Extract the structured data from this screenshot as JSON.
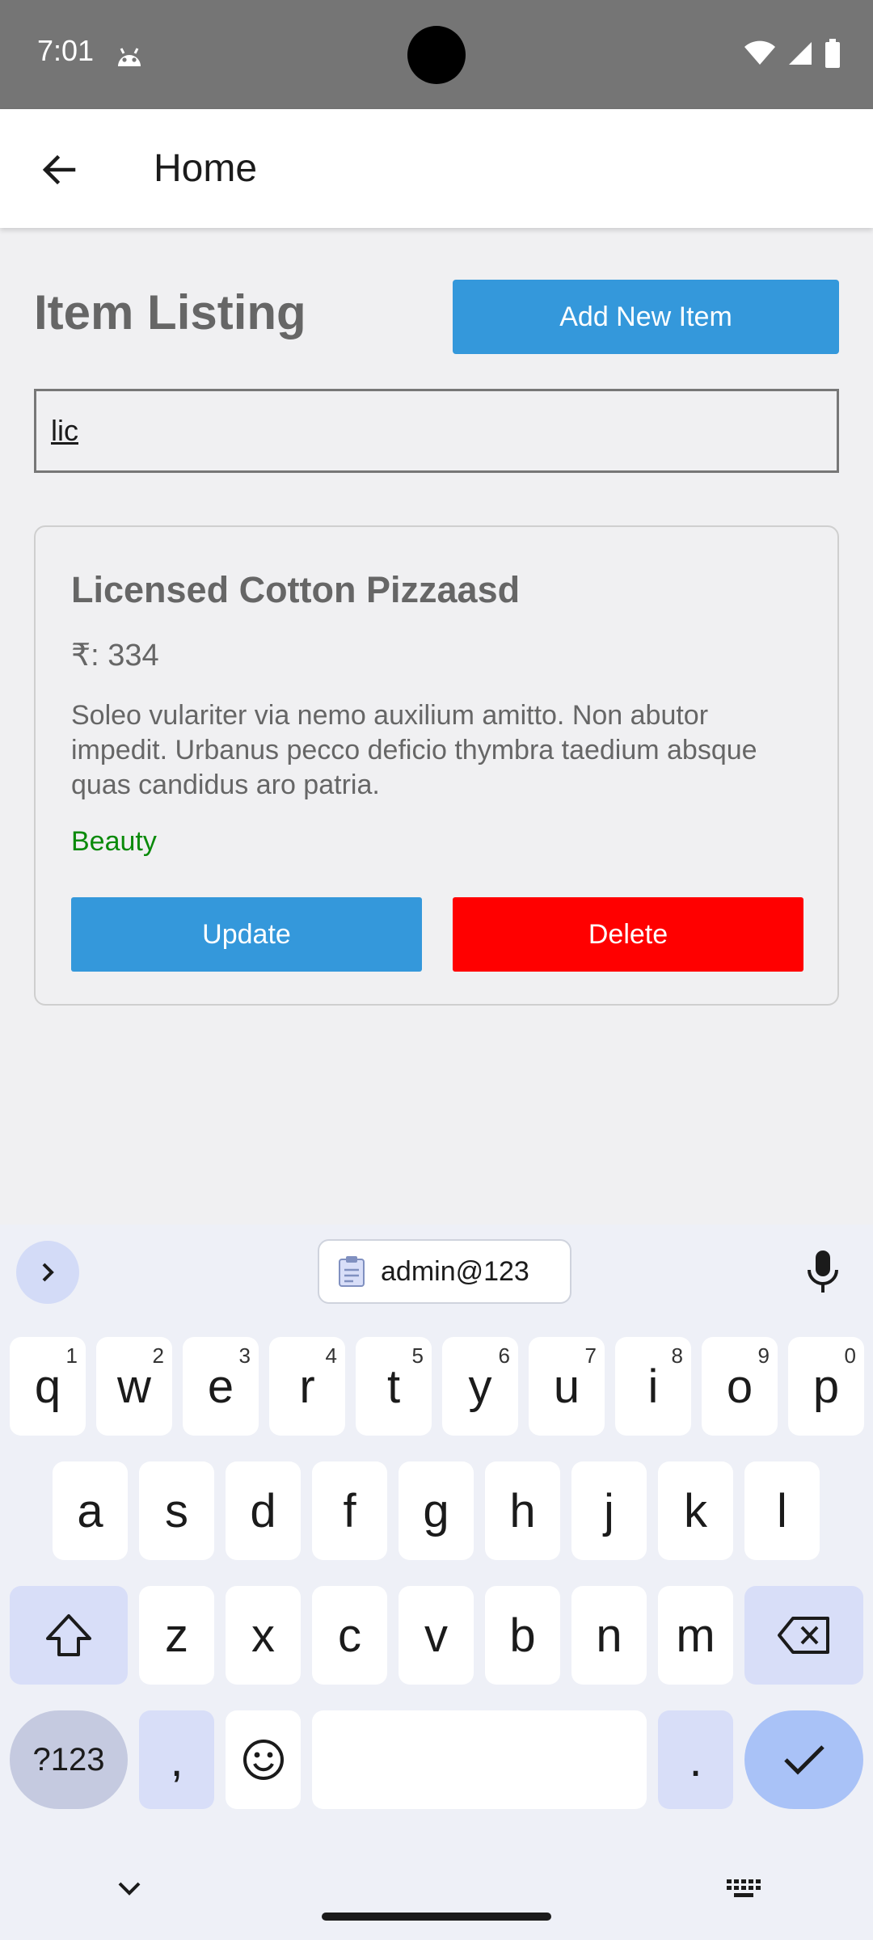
{
  "status_bar": {
    "time": "7:01",
    "icons": [
      "android-robot-icon",
      "wifi-icon",
      "signal-icon",
      "battery-icon"
    ]
  },
  "app_bar": {
    "title": "Home",
    "back_icon": "arrow-left-icon"
  },
  "main": {
    "heading": "Item Listing",
    "add_button_label": "Add New Item",
    "search_value": "lic",
    "items": [
      {
        "title": "Licensed Cotton Pizzaasd",
        "price": "₹: 334",
        "description": "Soleo vulariter via nemo auxilium amitto. Non abutor impedit. Urbanus pecco deficio thymbra taedium absque quas candidus aro patria.",
        "category": "Beauty",
        "update_label": "Update",
        "delete_label": "Delete"
      }
    ]
  },
  "keyboard": {
    "clipboard_suggestion": "admin@123",
    "row1": [
      {
        "k": "q",
        "s": "1"
      },
      {
        "k": "w",
        "s": "2"
      },
      {
        "k": "e",
        "s": "3"
      },
      {
        "k": "r",
        "s": "4"
      },
      {
        "k": "t",
        "s": "5"
      },
      {
        "k": "y",
        "s": "6"
      },
      {
        "k": "u",
        "s": "7"
      },
      {
        "k": "i",
        "s": "8"
      },
      {
        "k": "o",
        "s": "9"
      },
      {
        "k": "p",
        "s": "0"
      }
    ],
    "row2": [
      "a",
      "s",
      "d",
      "f",
      "g",
      "h",
      "j",
      "k",
      "l"
    ],
    "row3": [
      "z",
      "x",
      "c",
      "v",
      "b",
      "n",
      "m"
    ],
    "symbols_label": "?123",
    "comma": ",",
    "period": "."
  },
  "colors": {
    "accent": "#3498db",
    "danger": "#ff0000",
    "category": "#0a8a0a",
    "status_bar": "#757575"
  }
}
